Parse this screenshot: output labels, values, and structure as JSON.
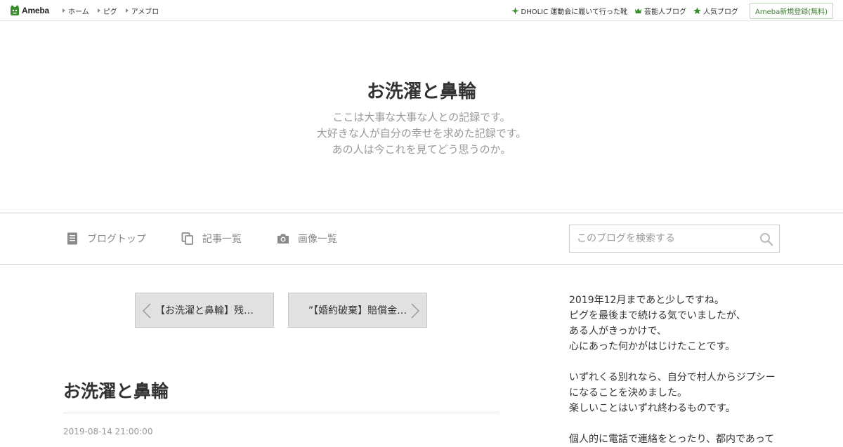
{
  "topbar": {
    "logo": "Ameba",
    "nav": [
      "ホーム",
      "ピグ",
      "アメブロ"
    ],
    "links": [
      {
        "label": "DHOLIC 運動会に履いて行った靴",
        "icon": "sparkle-icon"
      },
      {
        "label": "芸能人ブログ",
        "icon": "crown-icon"
      },
      {
        "label": "人気ブログ",
        "icon": "star-icon"
      }
    ],
    "register": "Ameba新規登録(無料)",
    "accent": "#3a7d2e"
  },
  "header": {
    "title": "お洗濯と鼻輪",
    "description": [
      "ここは大事な大事な人との記録です。",
      "大好きな人が自分の幸せを求めた記録です。",
      "あの人は今これを見てどう思うのか。"
    ]
  },
  "blog_nav": {
    "items": [
      {
        "label": "ブログトップ",
        "icon": "document-icon"
      },
      {
        "label": "記事一覧",
        "icon": "copy-icon"
      },
      {
        "label": "画像一覧",
        "icon": "camera-icon"
      }
    ],
    "search_placeholder": "このブログを検索する"
  },
  "pager": {
    "prev": "【お洗濯と鼻輪】残…",
    "next": "”【婚約破棄】賠償金…"
  },
  "entry": {
    "title": "お洗濯と鼻輪",
    "date": "2019-08-14 21:00:00"
  },
  "sidebar": {
    "paragraphs": [
      [
        "2019年12月まであと少しですね。",
        "ピグを最後まで続ける気でいましたが、",
        "ある人がきっかけで、",
        "心にあった何かがはじけたことです。"
      ],
      [
        "いずれくる別れなら、自分で村人からジプシー",
        "になることを決めました。",
        "楽しいことはいずれ終わるものです。"
      ],
      [
        "個人的に電話で連絡をとったり、都内であって"
      ]
    ]
  }
}
